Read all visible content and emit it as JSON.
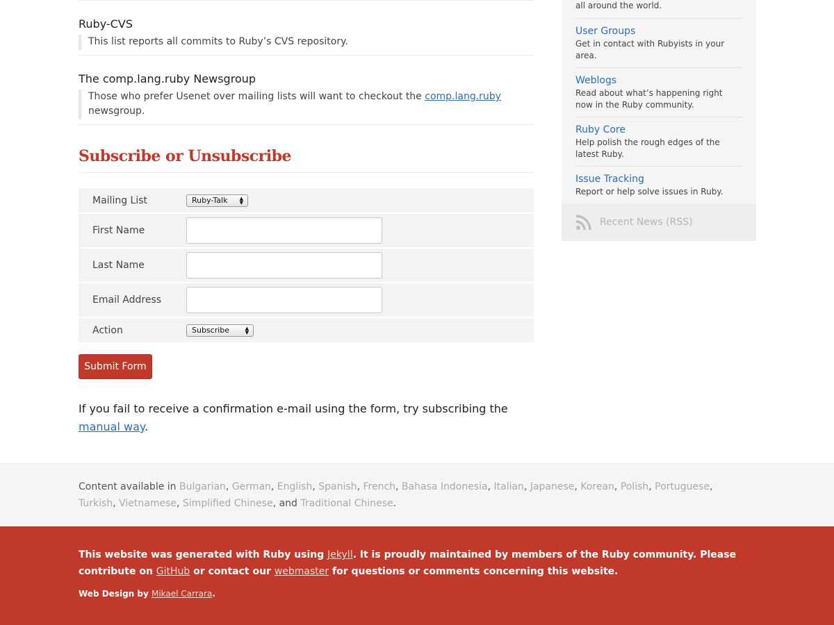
{
  "mailing_lists": {
    "cvs": {
      "title": "Ruby-CVS",
      "description": "This list reports all commits to Ruby’s CVS repository."
    },
    "newsgroup": {
      "title": "The comp.lang.ruby Newsgroup",
      "description_before": "Those who prefer Usenet over mailing lists will want to checkout the ",
      "link": "comp.lang.ruby",
      "description_after": "newsgroup."
    }
  },
  "subscribe": {
    "heading": "Subscribe or Unsubscribe",
    "fields": {
      "mailing_list": {
        "label": "Mailing List",
        "value": "Ruby-Talk"
      },
      "first_name": {
        "label": "First Name",
        "value": ""
      },
      "last_name": {
        "label": "Last Name",
        "value": ""
      },
      "email": {
        "label": "Email Address",
        "value": ""
      },
      "action": {
        "label": "Action",
        "value": "Subscribe"
      }
    },
    "submit_label": "Submit Form",
    "confirm_before": "If you fail to receive a confirmation e-mail using the form, try subscribing the ",
    "confirm_link": "manual way",
    "confirm_after": "."
  },
  "sidebar": {
    "fragment": "all around the world.",
    "items": [
      {
        "title": "User Groups",
        "desc": "Get in contact with Rubyists in your area."
      },
      {
        "title": "Weblogs",
        "desc": "Read about what’s happening right now in the Ruby community."
      },
      {
        "title": "Ruby Core",
        "desc": "Help polish the rough edges of the latest Ruby."
      },
      {
        "title": "Issue Tracking",
        "desc": "Report or help solve issues in Ruby."
      }
    ],
    "rss_label": "Recent News (RSS)"
  },
  "languages": {
    "prefix": "Content available in ",
    "list": [
      "Bulgarian",
      "German",
      "English",
      "Spanish",
      "French",
      "Bahasa Indonesia",
      "Italian",
      "Japanese",
      "Korean",
      "Polish",
      "Portuguese",
      "Turkish",
      "Vietnamese",
      "Simplified Chinese"
    ],
    "conjunction": ", and ",
    "last": "Traditional Chinese",
    "suffix": "."
  },
  "footer": {
    "t1": "This website was generated with Ruby using ",
    "jekyll": "Jekyll",
    "t2": ". It is proudly maintained by members of the Ruby community. Please contribute on ",
    "github": "GitHub",
    "t3": " or contact our ",
    "webmaster": "webmaster",
    "t4": " for questions or comments concerning this website.",
    "credit_prefix": "Web Design by ",
    "credit_name": "Mikael Carrara",
    "credit_suffix": "."
  },
  "colors": {
    "ruby_red": "#c0392b",
    "link_blue": "#2a6ebb",
    "panel_gray": "#f5f5f5"
  }
}
